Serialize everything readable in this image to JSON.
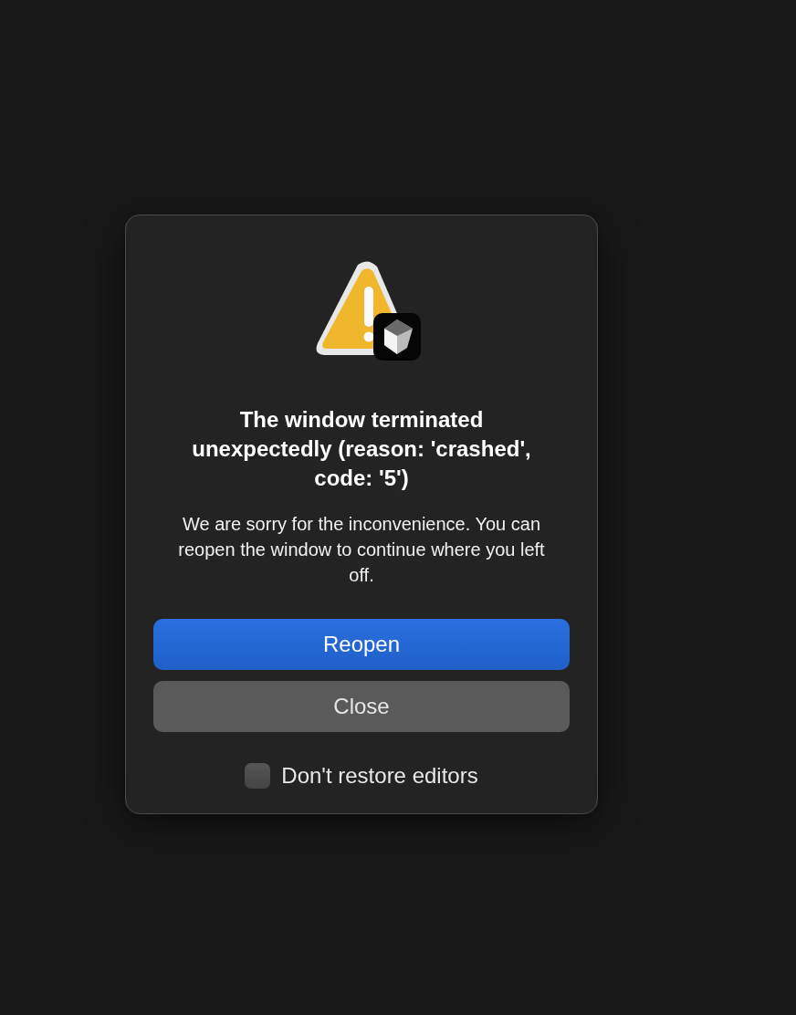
{
  "dialog": {
    "title": "The window terminated unexpectedly (reason: 'crashed', code: '5')",
    "message": "We are sorry for the inconvenience. You can reopen the window to continue where you left off.",
    "buttons": [
      {
        "label": "Reopen",
        "kind": "primary"
      },
      {
        "label": "Close",
        "kind": "secondary"
      }
    ],
    "checkbox": {
      "label": "Don't restore editors",
      "checked": false
    }
  }
}
